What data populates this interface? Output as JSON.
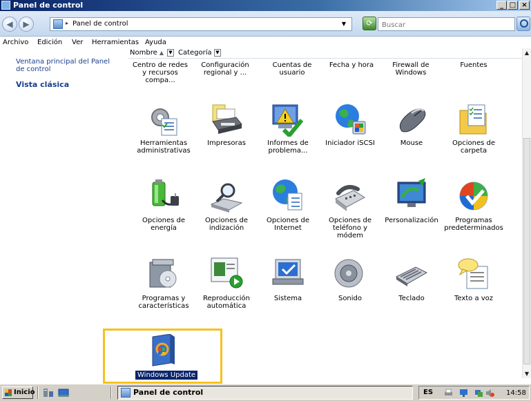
{
  "window": {
    "title": "Panel de control"
  },
  "nav": {
    "breadcrumb": "Panel de control",
    "search_placeholder": "Buscar"
  },
  "menu": [
    "Archivo",
    "Edición",
    "Ver",
    "Herramientas",
    "Ayuda"
  ],
  "left_pane": {
    "home_link": "Ventana principal del Panel de control",
    "classic_view": "Vista clásica"
  },
  "columns": {
    "name": "Nombre",
    "category": "Categoría"
  },
  "items": [
    {
      "label": "Centro de redes y recursos compa..."
    },
    {
      "label": "Configuración regional y ..."
    },
    {
      "label": "Cuentas de usuario"
    },
    {
      "label": "Fecha y hora"
    },
    {
      "label": "Firewall de Windows"
    },
    {
      "label": "Fuentes"
    },
    {
      "label": "Herramientas administrativas",
      "icon": "admin-tools-icon"
    },
    {
      "label": "Impresoras",
      "icon": "printer-icon"
    },
    {
      "label": "Informes de problema...",
      "icon": "problem-reports-icon"
    },
    {
      "label": "Iniciador iSCSI",
      "icon": "iscsi-globe-icon"
    },
    {
      "label": "Mouse",
      "icon": "mouse-icon"
    },
    {
      "label": "Opciones de carpeta",
      "icon": "folder-options-icon"
    },
    {
      "label": "Opciones de energía",
      "icon": "battery-plug-icon"
    },
    {
      "label": "Opciones de indización",
      "icon": "magnifier-drive-icon"
    },
    {
      "label": "Opciones de Internet",
      "icon": "internet-globe-icon"
    },
    {
      "label": "Opciones de teléfono y módem",
      "icon": "telephone-icon"
    },
    {
      "label": "Personalización",
      "icon": "monitor-paint-icon"
    },
    {
      "label": "Programas predeterminados",
      "icon": "windows-check-icon"
    },
    {
      "label": "Programas y características",
      "icon": "programs-box-icon"
    },
    {
      "label": "Reproducción automática",
      "icon": "autoplay-icon"
    },
    {
      "label": "Sistema",
      "icon": "system-monitor-icon"
    },
    {
      "label": "Sonido",
      "icon": "speaker-icon"
    },
    {
      "label": "Teclado",
      "icon": "keyboard-icon"
    },
    {
      "label": "Texto a voz",
      "icon": "speech-bubble-icon"
    },
    {
      "label": "Windows Update",
      "icon": "windows-update-icon",
      "selected": true
    }
  ],
  "taskbar": {
    "start": "Inicio",
    "task": "Panel de control",
    "lang": "ES",
    "clock": "14:58"
  },
  "colors": {
    "link": "#1a3f8c",
    "selection_highlight": "#f5c21b",
    "selected_label_bg": "#0a246a"
  }
}
